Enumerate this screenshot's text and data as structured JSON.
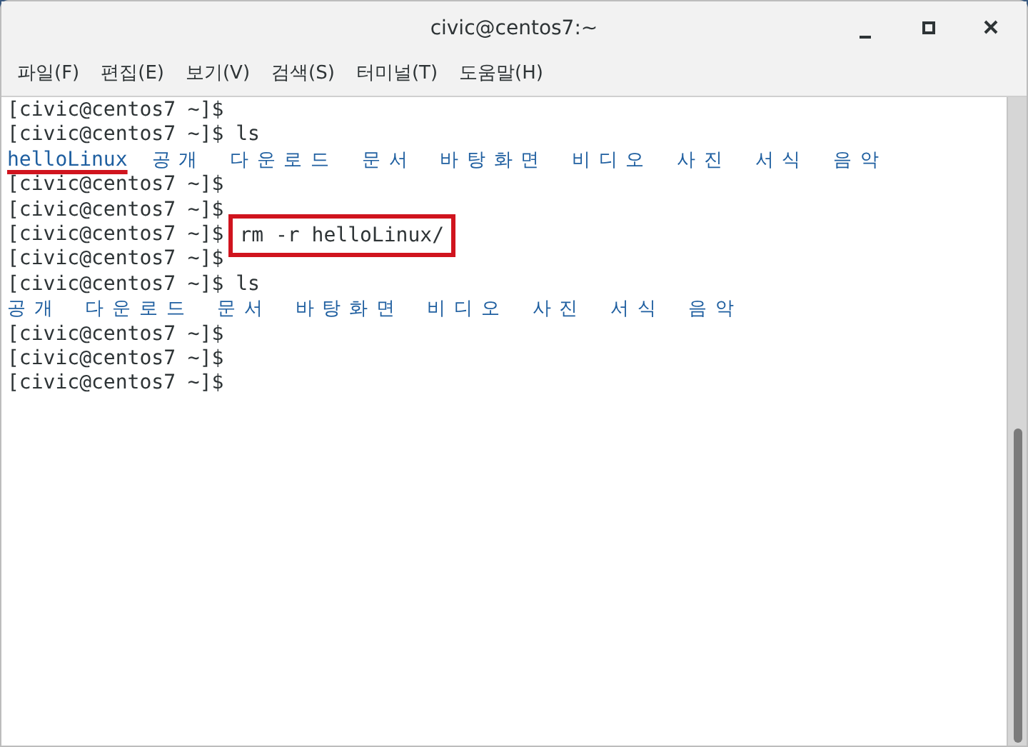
{
  "window": {
    "title": "civic@centos7:~"
  },
  "menu": [
    "파일(F)",
    "편집(E)",
    "보기(V)",
    "검색(S)",
    "터미널(T)",
    "도움말(H)"
  ],
  "terminal": {
    "lines": [
      {
        "kind": "prompt",
        "prompt": "[civic@centos7 ~]$"
      },
      {
        "kind": "prompt",
        "prompt": "[civic@centos7 ~]$",
        "command": "ls"
      },
      {
        "kind": "listing",
        "items": [
          {
            "text": "helloLinux",
            "underlined": true
          },
          {
            "text": "공개",
            "underlined": false
          },
          {
            "text": "다운로드",
            "underlined": false
          },
          {
            "text": "문서",
            "underlined": false
          },
          {
            "text": "바탕화면",
            "underlined": false
          },
          {
            "text": "비디오",
            "underlined": false
          },
          {
            "text": "사진",
            "underlined": false
          },
          {
            "text": "서식",
            "underlined": false
          },
          {
            "text": "음악",
            "underlined": false
          }
        ]
      },
      {
        "kind": "prompt",
        "prompt": "[civic@centos7 ~]$"
      },
      {
        "kind": "prompt",
        "prompt": "[civic@centos7 ~]$"
      },
      {
        "kind": "prompt",
        "prompt": "[civic@centos7 ~]$",
        "command": "rm -r helloLinux/",
        "boxed": true
      },
      {
        "kind": "prompt",
        "prompt": "[civic@centos7 ~]$"
      },
      {
        "kind": "prompt",
        "prompt": "[civic@centos7 ~]$",
        "command": "ls"
      },
      {
        "kind": "listing",
        "items": [
          {
            "text": "공개",
            "underlined": false
          },
          {
            "text": "다운로드",
            "underlined": false
          },
          {
            "text": "문서",
            "underlined": false
          },
          {
            "text": "바탕화면",
            "underlined": false
          },
          {
            "text": "비디오",
            "underlined": false
          },
          {
            "text": "사진",
            "underlined": false
          },
          {
            "text": "서식",
            "underlined": false
          },
          {
            "text": "음악",
            "underlined": false
          }
        ]
      },
      {
        "kind": "prompt",
        "prompt": "[civic@centos7 ~]$"
      },
      {
        "kind": "prompt",
        "prompt": "[civic@centos7 ~]$"
      },
      {
        "kind": "prompt",
        "prompt": "[civic@centos7 ~]$"
      }
    ]
  }
}
